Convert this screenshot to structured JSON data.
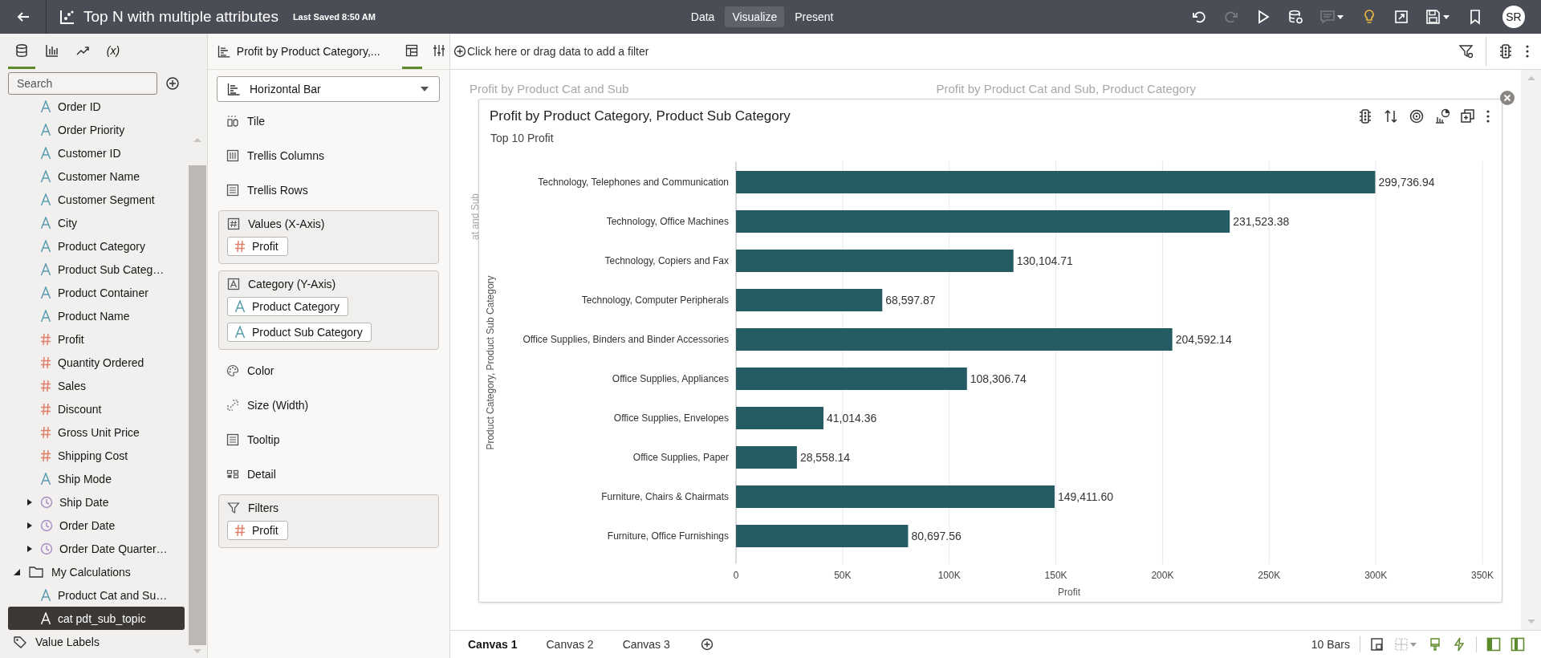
{
  "top_bar": {
    "title": "Top N with multiple attributes",
    "last_saved": "Last Saved 8:50 AM",
    "modes": [
      {
        "label": "Data",
        "selected": false
      },
      {
        "label": "Visualize",
        "selected": true
      },
      {
        "label": "Present",
        "selected": false
      }
    ],
    "actions": [
      {
        "kind": "undo",
        "disabled": false
      },
      {
        "kind": "redo",
        "disabled": true
      },
      {
        "kind": "play",
        "disabled": false
      },
      {
        "kind": "refresh_data",
        "disabled": false
      },
      {
        "kind": "comments",
        "disabled": true
      },
      {
        "kind": "insights",
        "disabled": false
      },
      {
        "kind": "export",
        "disabled": false
      },
      {
        "kind": "save",
        "disabled": false
      },
      {
        "kind": "bookmark",
        "disabled": false
      }
    ],
    "avatar": "SR"
  },
  "data_panel": {
    "tabs": [
      {
        "kind": "data",
        "selected": true
      },
      {
        "kind": "visualizations",
        "selected": false
      },
      {
        "kind": "analytics",
        "selected": false
      },
      {
        "kind": "calculation",
        "label": "(x)",
        "selected": false
      }
    ],
    "search": {
      "placeholder": "Search"
    },
    "fields": [
      {
        "label": "Order ID",
        "kind": "text",
        "selected": false
      },
      {
        "label": "Order Priority",
        "kind": "text",
        "selected": false
      },
      {
        "label": "Customer ID",
        "kind": "text",
        "selected": false
      },
      {
        "label": "Customer Name",
        "kind": "text",
        "selected": false
      },
      {
        "label": "Customer Segment",
        "kind": "text",
        "selected": false
      },
      {
        "label": "City",
        "kind": "text",
        "selected": false
      },
      {
        "label": "Product Category",
        "kind": "text",
        "selected": false
      },
      {
        "label": "Product Sub Categ…",
        "kind": "text",
        "selected": false
      },
      {
        "label": "Product Container",
        "kind": "text",
        "selected": false
      },
      {
        "label": "Product Name",
        "kind": "text",
        "selected": false
      },
      {
        "label": "Profit",
        "kind": "number",
        "selected": false
      },
      {
        "label": "Quantity Ordered",
        "kind": "number",
        "selected": false
      },
      {
        "label": "Sales",
        "kind": "number",
        "selected": false
      },
      {
        "label": "Discount",
        "kind": "number",
        "selected": false
      },
      {
        "label": "Gross Unit Price",
        "kind": "number",
        "selected": false
      },
      {
        "label": "Shipping Cost",
        "kind": "number",
        "selected": false
      },
      {
        "label": "Ship Mode",
        "kind": "text",
        "selected": false
      },
      {
        "label": "Ship Date",
        "kind": "date",
        "expanded": false,
        "selected": false
      },
      {
        "label": "Order Date",
        "kind": "date",
        "expanded": false,
        "selected": false
      },
      {
        "label": "Order Date Quarter…",
        "kind": "date",
        "expanded": false,
        "selected": false
      }
    ],
    "folders": [
      {
        "label": "My Calculations",
        "expanded": true,
        "children": [
          {
            "label": "Product Cat and Su…",
            "kind": "text",
            "selected": false
          },
          {
            "label": "cat pdt_sub_topic",
            "kind": "text",
            "selected": true
          }
        ]
      }
    ],
    "value_labels": {
      "label": "Value Labels"
    }
  },
  "grammar_panel": {
    "title": "Profit by Product Category,...",
    "tabs": [
      {
        "kind": "properties",
        "selected": true
      },
      {
        "kind": "settings",
        "selected": false
      }
    ],
    "viz_type": {
      "value": "Horizontal Bar"
    },
    "sections": [
      {
        "kind": "tile",
        "label": "Tile"
      },
      {
        "kind": "trellis_columns",
        "label": "Trellis Columns"
      },
      {
        "kind": "trellis_rows",
        "label": "Trellis Rows"
      },
      {
        "kind": "values",
        "label": "Values (X-Axis)",
        "pills": [
          {
            "label": "Profit",
            "kind": "number"
          }
        ]
      },
      {
        "kind": "category",
        "label": "Category (Y-Axis)",
        "pills": [
          {
            "label": "Product Category",
            "kind": "text"
          },
          {
            "label": "Product Sub Category",
            "kind": "text"
          }
        ]
      },
      {
        "kind": "color",
        "label": "Color"
      },
      {
        "kind": "size",
        "label": "Size (Width)"
      },
      {
        "kind": "tooltip",
        "label": "Tooltip"
      },
      {
        "kind": "detail",
        "label": "Detail"
      },
      {
        "kind": "filters",
        "label": "Filters",
        "pills": [
          {
            "label": "Profit",
            "kind": "number"
          }
        ]
      }
    ]
  },
  "filter_bar": {
    "prompt": "Click here or drag data to add a filter"
  },
  "canvas": {
    "background_titles": [
      "Profit by Product Cat and Sub",
      "Profit by Product Cat and Sub, Product Category"
    ],
    "background_axis_title": "at and Sub",
    "visualization": {
      "title": "Profit by Product Category, Product Sub Category",
      "subtitle": "Top 10 Profit",
      "chart_data": {
        "type": "bar",
        "orientation": "horizontal",
        "xlabel": "Profit",
        "ylabel": "Product Category, Product Sub Category",
        "categories": [
          "Technology, Telephones and Communication",
          "Technology, Office Machines",
          "Technology, Copiers and Fax",
          "Technology, Computer Peripherals",
          "Office Supplies, Binders and Binder Accessories",
          "Office Supplies, Appliances",
          "Office Supplies, Envelopes",
          "Office Supplies, Paper",
          "Furniture, Chairs & Chairmats",
          "Furniture, Office Furnishings"
        ],
        "series": [
          {
            "color": "#255c63",
            "values": [
              299736.94,
              231523.38,
              130104.71,
              68597.87,
              204592.14,
              108306.74,
              41014.36,
              28558.14,
              149411.6,
              80697.56
            ]
          }
        ],
        "value_labels": [
          "299,736.94",
          "231,523.38",
          "130,104.71",
          "68,597.87",
          "204,592.14",
          "108,306.74",
          "41,014.36",
          "28,558.14",
          "149,411.60",
          "80,697.56"
        ],
        "grid": true,
        "xlim": [
          0,
          350000
        ],
        "xticks": [
          {
            "value": 0,
            "label": "0"
          },
          {
            "value": 50000,
            "label": "50K"
          },
          {
            "value": 100000,
            "label": "100K"
          },
          {
            "value": 150000,
            "label": "150K"
          },
          {
            "value": 200000,
            "label": "200K"
          },
          {
            "value": 250000,
            "label": "250K"
          },
          {
            "value": 300000,
            "label": "300K"
          },
          {
            "value": 350000,
            "label": "350K"
          }
        ]
      }
    }
  },
  "bottom_bar": {
    "canvases": [
      {
        "label": "Canvas 1",
        "selected": true
      },
      {
        "label": "Canvas 2",
        "selected": false
      },
      {
        "label": "Canvas 3",
        "selected": false
      }
    ],
    "status": "10 Bars"
  }
}
